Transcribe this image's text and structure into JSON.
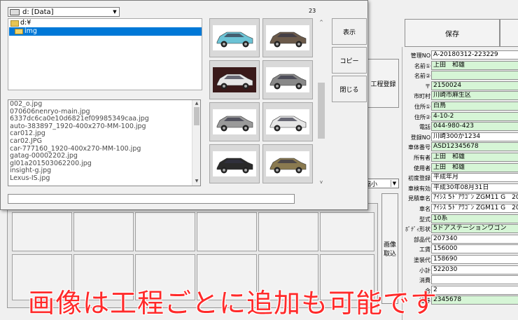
{
  "toolbar": {
    "save_label": "保存"
  },
  "side": {
    "process_register_label": "工程登録",
    "image_import_label": "画像\n取込"
  },
  "shrink_select": "縮小",
  "fields": [
    {
      "label": "管理NO",
      "value": "A-20180312-223229",
      "style": "white"
    },
    {
      "label": "名前①",
      "value": "上田　和雄",
      "style": "green"
    },
    {
      "label": "名前②",
      "value": "",
      "style": "green"
    },
    {
      "label": "〒",
      "value": "2150024",
      "style": "green"
    },
    {
      "label": "市町村",
      "value": "川崎市麻生区",
      "style": "green"
    },
    {
      "label": "住所①",
      "value": "白鳥",
      "style": "green"
    },
    {
      "label": "住所②",
      "value": "4-10-2",
      "style": "green"
    },
    {
      "label": "電話",
      "value": "044-980-423",
      "style": "green"
    },
    {
      "label": "登録NO",
      "value": "川崎300か1234",
      "style": "white"
    },
    {
      "label": "車体番号",
      "value": "ASD12345678",
      "style": "green"
    },
    {
      "label": "所有者",
      "value": "上田　和雄",
      "style": "green"
    },
    {
      "label": "使用者",
      "value": "上田　和雄",
      "style": "green"
    },
    {
      "label": "初度登録",
      "value": "平成年月",
      "style": "white"
    },
    {
      "label": "車検有効",
      "value": "平成30年08月31日",
      "style": "white"
    },
    {
      "label": "見積車名",
      "value": "ｱｲｼｽ 5ﾄﾞｱﾜｺﾞﾝ ZGM11 G　20",
      "style": "white"
    },
    {
      "label": "車名",
      "value": "ｱｲｼｽ 5ﾄﾞｱﾜｺﾞﾝ ZGM11 G　20",
      "style": "white"
    },
    {
      "label": "型式",
      "value": "10系",
      "style": "green"
    },
    {
      "label": "ﾎﾞﾃﾞｨ形状",
      "value": "5ドアステーションワゴン",
      "style": "green"
    },
    {
      "label": "部品代",
      "value": "207340",
      "style": "white"
    },
    {
      "label": "工賃",
      "value": "156000",
      "style": "white"
    },
    {
      "label": "塗装代",
      "value": "158690",
      "style": "white"
    },
    {
      "label": "小計",
      "value": "522030",
      "style": "white"
    },
    {
      "label": "消費",
      "value": "",
      "style": "white"
    },
    {
      "label": "合",
      "value": "2",
      "style": "white"
    },
    {
      "label": "証券",
      "value": "2345678",
      "style": "green"
    }
  ],
  "dialog": {
    "drive_label": "d: [Data]",
    "counter": "23",
    "folders": [
      "d:¥",
      "img"
    ],
    "files": [
      "002_o.jpg",
      "070606nenryo-main.jpg",
      "6337dc6ca0e10d6821ef09985349caa.jpg",
      "auto-383897_1920-400x270-MM-100.jpg",
      "car012.jpg",
      "car02.JPG",
      "car-777160_1920-400x270-MM-100.jpg",
      "gatag-00002202.jpg",
      "gl01a201503062200.jpg",
      "insight-g.jpg",
      "Lexus-IS.jpg"
    ],
    "buttons": {
      "show": "表示",
      "copy": "コピー",
      "close": "閉じる"
    }
  },
  "overlay_caption": "画像は工程ごとに追加も可能です",
  "colors": {
    "field_green": "#d6f5d6",
    "selected_blue": "#0078d7",
    "overlay_red": "#ff2a2a"
  }
}
